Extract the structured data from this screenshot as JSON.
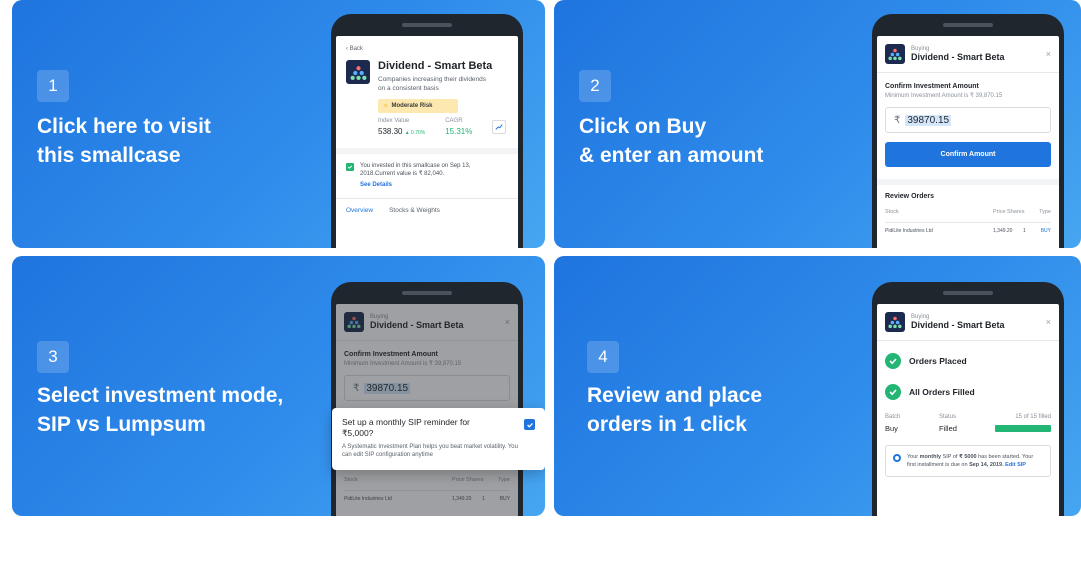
{
  "cards": {
    "c1": {
      "num": "1",
      "text": "Click here to visit\nthis smallcase"
    },
    "c2": {
      "num": "2",
      "text": "Click on Buy\n& enter an amount"
    },
    "c3": {
      "num": "3",
      "text": "Select investment mode,\nSIP vs Lumpsum"
    },
    "c4": {
      "num": "4",
      "text": "Review and place\norders in 1 click"
    }
  },
  "smallcase": {
    "back": "‹ Back",
    "name": "Dividend - Smart Beta",
    "description": "Companies increasing their dividends on a consistent basis",
    "risk": "Moderate Risk",
    "index_label": "Index Value",
    "index_value": "538.30",
    "index_change": "▲ 0.70%",
    "cagr_label": "CAGR",
    "cagr_value": "15.31%",
    "invested_note": "You invested in this smallcase on Sep 13, 2018.Current value is ₹ 82,040.",
    "see_details": "See Details",
    "tab_overview": "Overview",
    "tab_stocks": "Stocks & Weights"
  },
  "buy": {
    "buying_label": "Buying",
    "name": "Dividend - Smart Beta",
    "close": "×",
    "confirm_title": "Confirm Investment Amount",
    "min_amount": "Minimum Investment Amount is ₹ 39,870.15",
    "currency": "₹",
    "amount": "39870.15",
    "confirm_button": "Confirm Amount",
    "review_title": "Review Orders",
    "col_stock": "Stock",
    "col_price_shares": "Price Shares",
    "col_type": "Type",
    "row_stock": "PidiLite Industries Ltd",
    "row_price": "1,349.20",
    "row_shares": "1",
    "row_type": "BUY"
  },
  "sip_popup": {
    "title": "Set up a monthly SIP reminder for ₹5,000?",
    "body": "A Systematic Investment Plan helps you beat market volatility. You can edit SIP configuration anytime",
    "checked": true
  },
  "placed": {
    "buying_label": "Buying",
    "name": "Dividend - Smart Beta",
    "close": "×",
    "orders_placed": "Orders Placed",
    "all_filled": "All Orders Filled",
    "batch_label": "Batch",
    "batch_value": "Buy",
    "status_label": "Status",
    "status_value": "Filled",
    "filled_count": "15 of 15 filled",
    "filled_fraction": 1.0,
    "sip_note_pre": "Your ",
    "sip_note_bold1": "monthly",
    "sip_note_mid": " SIP of ",
    "sip_note_bold2": "₹ 5000",
    "sip_note_post": " has been started. Your first installment is due on ",
    "sip_date": "Sep 14, 2019.",
    "edit_sip": "Edit SIP"
  },
  "colors": {
    "brand_blue": "#1f74de",
    "success_green": "#22b573",
    "risk_badge": "#fde9b0"
  }
}
